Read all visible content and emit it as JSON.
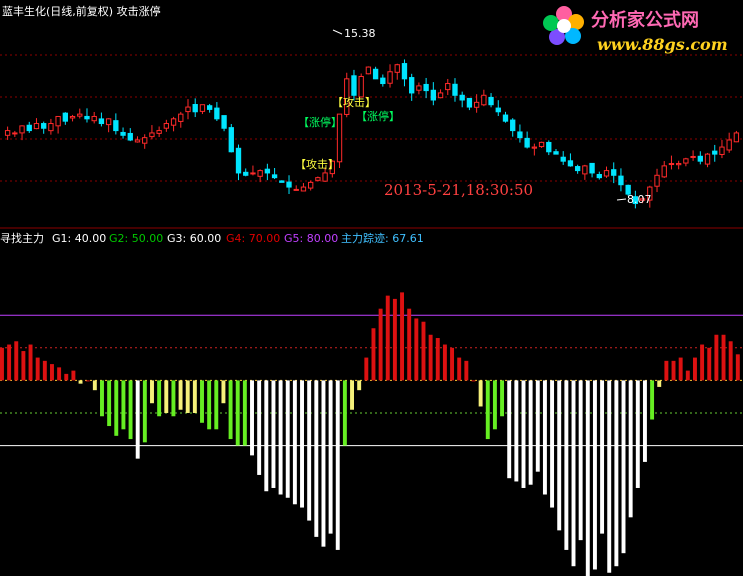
{
  "top_panel": {
    "title": "蓝丰生化(日线,前复权) 攻击涨停",
    "high_label": "15.38",
    "low_label": "8.07",
    "timestamp": "2013-5-21,18:30:50",
    "annotations": [
      {
        "id": "zt1",
        "text": "【涨停】"
      },
      {
        "id": "gj1",
        "text": "【攻击】"
      },
      {
        "id": "zt2",
        "text": "【涨停】"
      },
      {
        "id": "gj2",
        "text": "【攻击】"
      }
    ]
  },
  "bottom_panel": {
    "legend": [
      {
        "key": "name",
        "text": "寻找主力"
      },
      {
        "key": "g1",
        "text": "G1: 40.00",
        "color": "#ffffff"
      },
      {
        "key": "g2",
        "text": "G2: 50.00",
        "color": "#00c800"
      },
      {
        "key": "g3",
        "text": "G3: 60.00",
        "color": "#ffffff"
      },
      {
        "key": "g4",
        "text": "G4: 70.00",
        "color": "#e00000"
      },
      {
        "key": "g5",
        "text": "G5: 80.00",
        "color": "#c040ff"
      },
      {
        "key": "zl",
        "text": "主力踪迹: 67.61",
        "color": "#40c0ff"
      }
    ]
  },
  "logo": {
    "title": "分析家公式网",
    "url": "www.88gs.com"
  },
  "colors": {
    "up": "#ff2a2a",
    "down": "#00e5ff",
    "red_bar": "#dd1111",
    "yellow_bar": "#f5f07a",
    "green_bar": "#66ee22",
    "white_bar": "#ffffff",
    "grid": "#8b0000"
  },
  "chart_data": [
    {
      "type": "candlestick",
      "title": "蓝丰生化(日线,前复权) 攻击涨停",
      "ylim": [
        7.5,
        16.0
      ],
      "close": [
        11.3,
        11.2,
        11.5,
        11.3,
        11.6,
        11.4,
        11.6,
        11.9,
        11.7,
        11.9,
        12.0,
        11.8,
        11.9,
        11.6,
        11.8,
        11.3,
        11.1,
        10.9,
        10.9,
        11.0,
        11.2,
        11.3,
        11.6,
        11.8,
        12.0,
        12.3,
        12.1,
        12.4,
        12.2,
        11.8,
        11.4,
        10.4,
        9.5,
        9.4,
        9.5,
        9.6,
        9.5,
        9.3,
        9.1,
        8.9,
        8.8,
        8.9,
        9.1,
        9.3,
        9.5,
        10.0,
        12.0,
        13.5,
        12.8,
        13.6,
        14.0,
        13.5,
        13.3,
        13.8,
        14.1,
        13.5,
        12.9,
        13.2,
        13.0,
        12.6,
        12.9,
        13.3,
        12.8,
        12.6,
        12.3,
        12.5,
        12.8,
        12.4,
        12.1,
        11.7,
        11.3,
        11.0,
        10.6,
        10.6,
        10.8,
        10.4,
        10.3,
        10.0,
        9.8,
        9.6,
        9.8,
        9.5,
        9.3,
        9.6,
        9.4,
        9.0,
        8.6,
        8.2,
        8.4,
        8.9,
        9.4,
        9.8,
        9.9,
        9.9,
        10.1,
        10.2,
        10.0,
        10.3,
        10.3,
        10.6,
        10.9,
        11.2
      ],
      "annotations": [
        "15.38",
        "8.07",
        "【涨停】",
        "【攻击】",
        "2013-5-21,18:30:50"
      ]
    },
    {
      "type": "bar",
      "title": "寻找主力",
      "ylim": [
        0,
        100
      ],
      "reference_lines": {
        "G1": 40.0,
        "G2": 50.0,
        "G3": 60.0,
        "G4": 70.0,
        "G5": 80.0
      },
      "legend": [
        "G1: 40.00",
        "G2: 50.00",
        "G3: 60.00",
        "G4: 70.00",
        "G5: 80.00",
        "主力踪迹: 67.61"
      ],
      "values": [
        70,
        71,
        72,
        69,
        71,
        67,
        66,
        65,
        64,
        62,
        63,
        59,
        60,
        57,
        49,
        46,
        43,
        45,
        42,
        36,
        41,
        53,
        49,
        50,
        49,
        51,
        50,
        50,
        47,
        45,
        45,
        53,
        42,
        40,
        40,
        37,
        31,
        26,
        27,
        25,
        24,
        22,
        21,
        17,
        12,
        9,
        13,
        8,
        40,
        51,
        57,
        67,
        76,
        82,
        86,
        85,
        87,
        82,
        79,
        78,
        74,
        73,
        71,
        70,
        67,
        66,
        60,
        52,
        42,
        45,
        49,
        30,
        29,
        27,
        28,
        32,
        25,
        21,
        14,
        8,
        3,
        11,
        0,
        2,
        13,
        1,
        3,
        7,
        18,
        27,
        35,
        48,
        58,
        66,
        66,
        67,
        63,
        67,
        71,
        70,
        74,
        74,
        72,
        68
      ]
    }
  ]
}
